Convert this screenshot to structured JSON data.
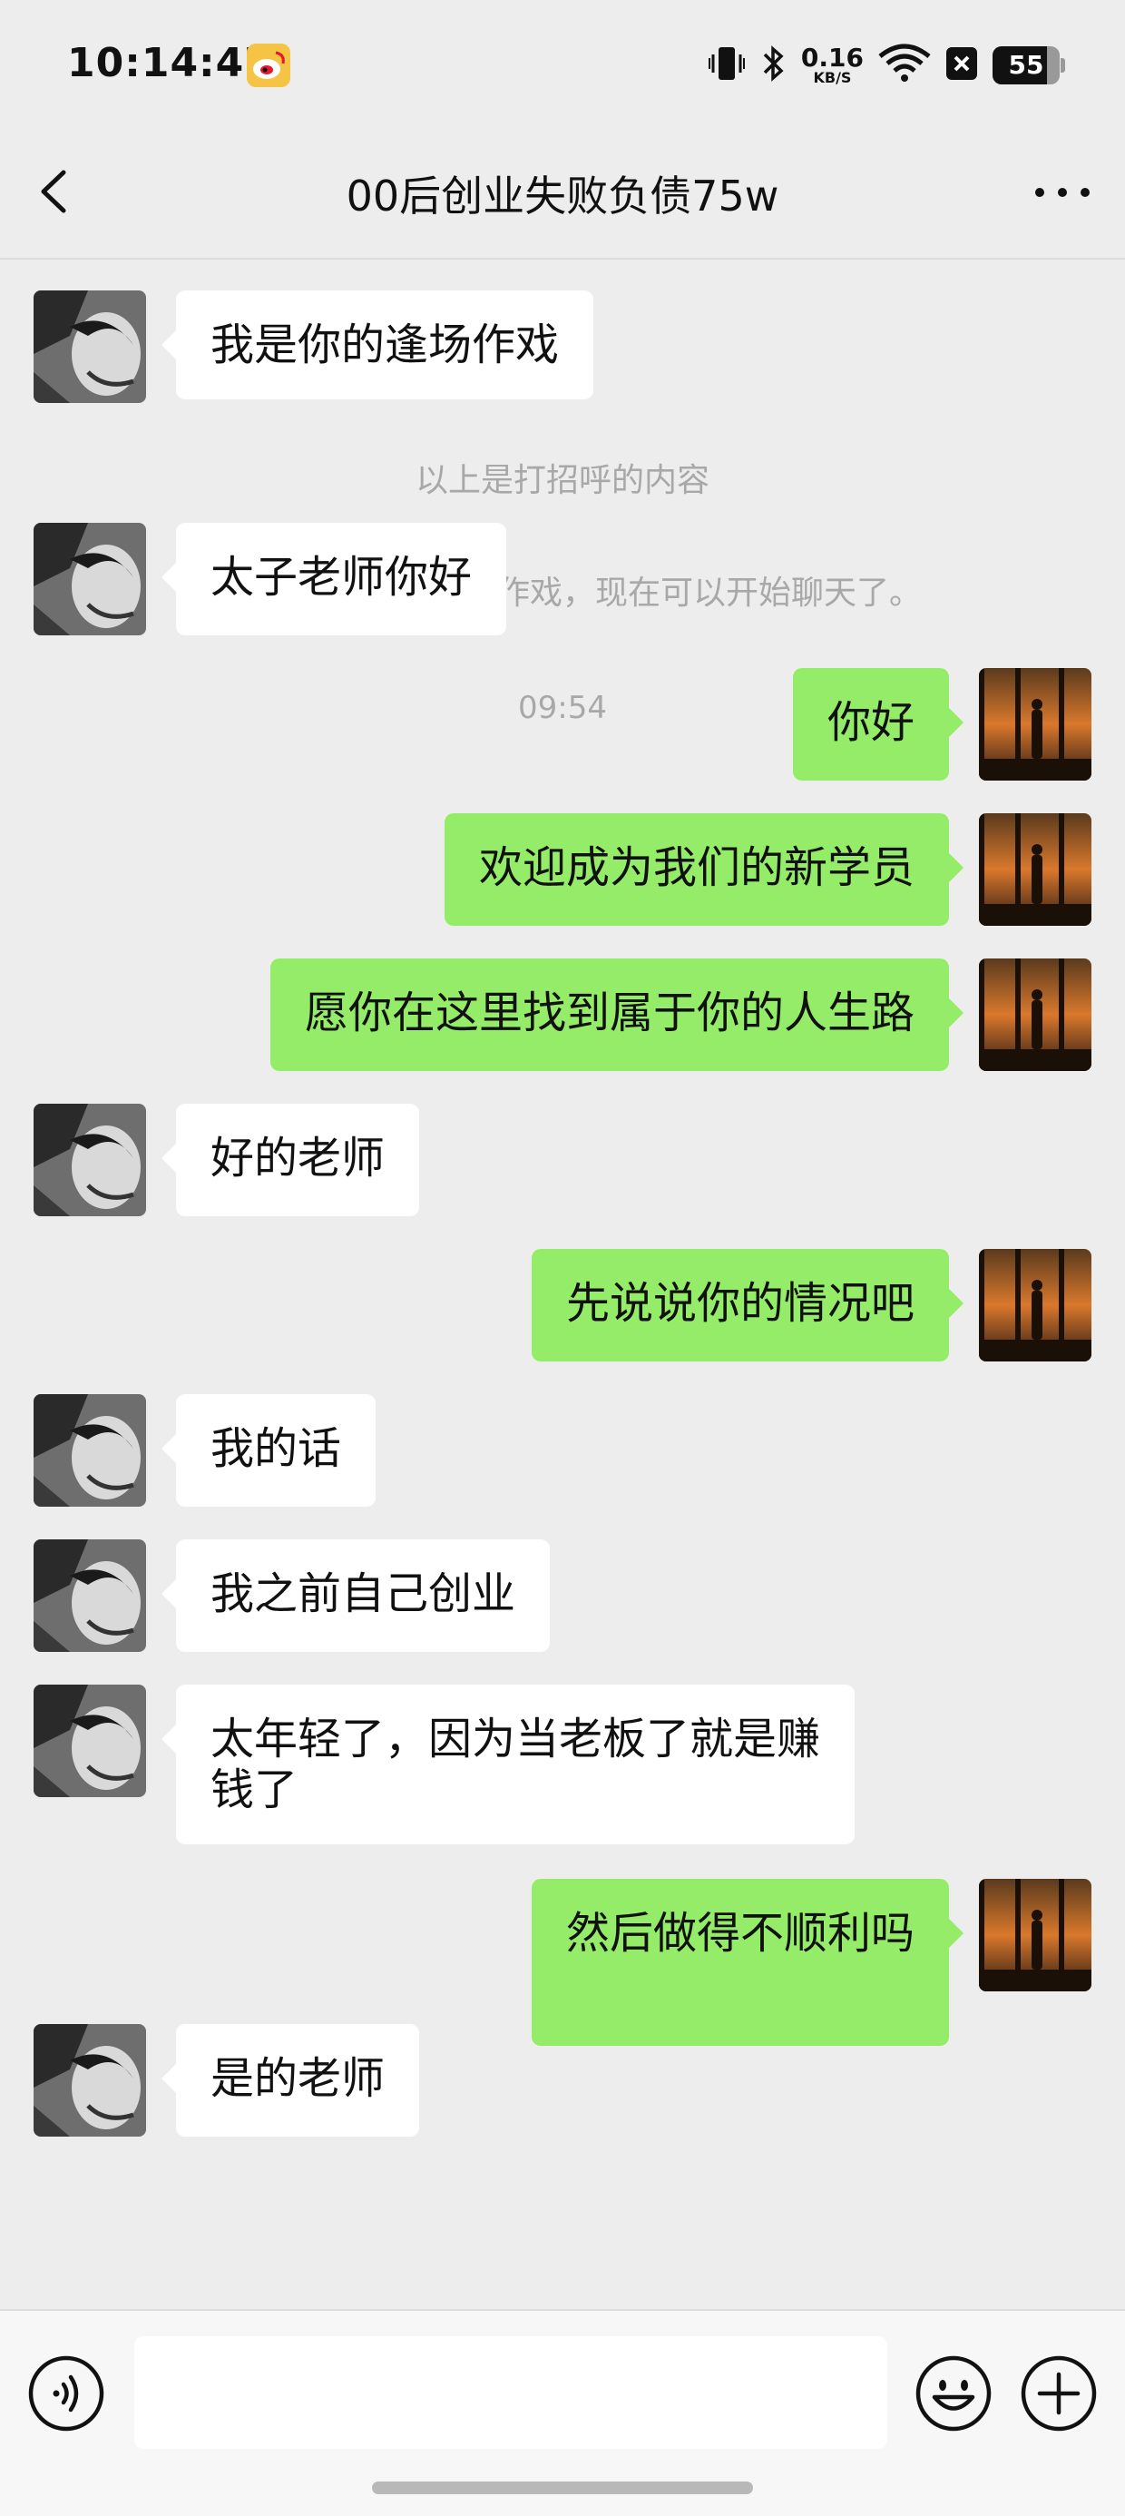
{
  "status_bar": {
    "time": "10:14:47",
    "net_speed": "0.16",
    "net_speed_unit": "KB/S",
    "battery": "55",
    "icons": [
      "weibo-icon",
      "vibrate-icon",
      "bluetooth-icon",
      "wifi-icon",
      "close-box-icon"
    ]
  },
  "header": {
    "title": "00后创业失败负债75w",
    "back_icon": "chevron-left-icon",
    "more_icon": "more-dots-icon"
  },
  "chat": {
    "greeting_message": "我是你的逢场作戏",
    "system_greeting_note": "以上是打招呼的内容",
    "system_added_note": "你已添加了你的逢场作戏，现在可以开始聊天了。",
    "timestamp": "09:54",
    "messages": [
      {
        "from": "them",
        "text": "太子老师你好"
      },
      {
        "from": "me",
        "text": "你好"
      },
      {
        "from": "me",
        "text": "欢迎成为我们的新学员"
      },
      {
        "from": "me",
        "text": "愿你在这里找到属于你的人生路"
      },
      {
        "from": "them",
        "text": "好的老师"
      },
      {
        "from": "me",
        "text": "先说说你的情况吧"
      },
      {
        "from": "them",
        "text": "我的话"
      },
      {
        "from": "them",
        "text": "我之前自己创业"
      },
      {
        "from": "them",
        "text": "太年轻了，因为当老板了就是赚\n钱了"
      },
      {
        "from": "me",
        "text": "然后做得不顺利吗"
      },
      {
        "from": "them",
        "text": "是的老师"
      }
    ]
  },
  "input_bar": {
    "voice_icon": "voice-icon",
    "input_value": "",
    "emoji_icon": "emoji-icon",
    "plus_icon": "plus-icon"
  },
  "colors": {
    "background": "#ededed",
    "outgoing_bubble": "#95ec69",
    "incoming_bubble": "#ffffff",
    "system_text": "#a8a8a8"
  }
}
